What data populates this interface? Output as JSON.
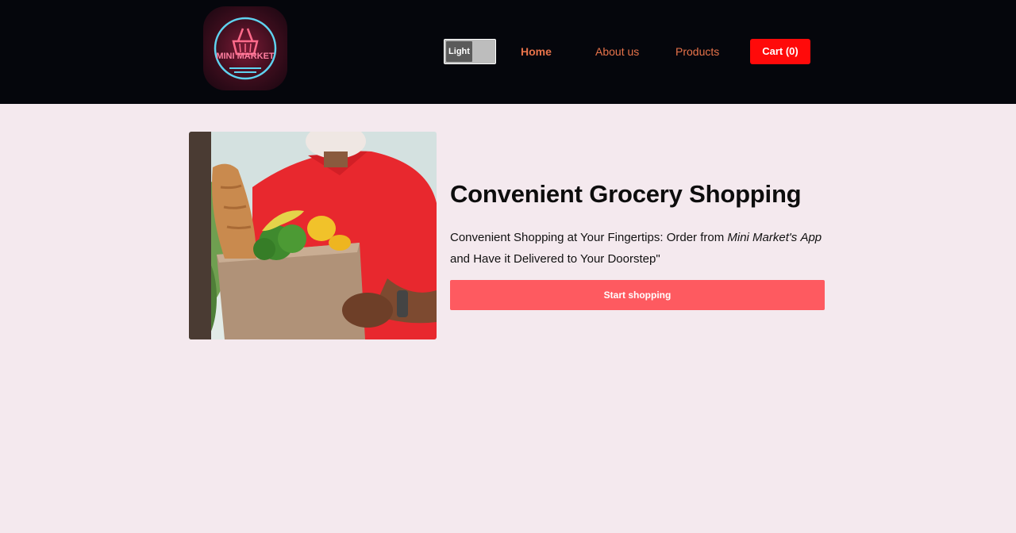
{
  "header": {
    "logo_text": "MINI MARKET",
    "theme_toggle_label": "Light",
    "nav": {
      "home": "Home",
      "about": "About us",
      "products": "Products"
    },
    "cart_label": "Cart (0)"
  },
  "hero": {
    "image_icon": "delivery-person-with-grocery-bag",
    "title": "Convenient Grocery Shopping",
    "text_part1": "Convenient Shopping at Your Fingertips: Order from ",
    "text_em1": "Mini Market's",
    "text_em2": "App",
    "text_part2": " and Have it Delivered to Your Doorstep\"",
    "button_label": "Start shopping"
  },
  "colors": {
    "header_bg": "#05060c",
    "page_bg": "#f4e9ee",
    "nav_link": "#e8734a",
    "cart_bg": "#ff0a0a",
    "primary_button": "#fe5a60"
  }
}
